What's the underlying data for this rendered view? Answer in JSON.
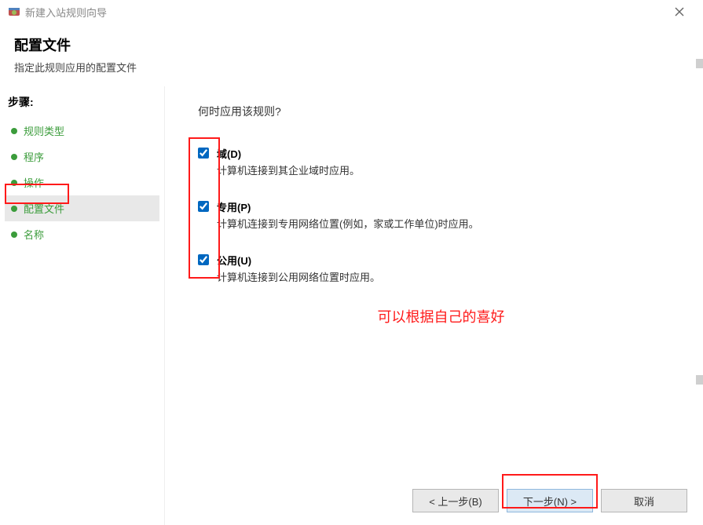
{
  "window": {
    "title": "新建入站规则向导"
  },
  "header": {
    "title": "配置文件",
    "subtitle": "指定此规则应用的配置文件"
  },
  "sidebar": {
    "steps_label": "步骤:",
    "items": [
      {
        "label": "规则类型"
      },
      {
        "label": "程序"
      },
      {
        "label": "操作"
      },
      {
        "label": "配置文件"
      },
      {
        "label": "名称"
      }
    ],
    "active_index": 3
  },
  "content": {
    "prompt": "何时应用该规则?",
    "checkboxes": [
      {
        "label": "域(D)",
        "desc": "计算机连接到其企业域时应用。",
        "checked": true
      },
      {
        "label": "专用(P)",
        "desc": "计算机连接到专用网络位置(例如，家或工作单位)时应用。",
        "checked": true
      },
      {
        "label": "公用(U)",
        "desc": "计算机连接到公用网络位置时应用。",
        "checked": true
      }
    ],
    "annotation": "可以根据自己的喜好"
  },
  "buttons": {
    "back": "< 上一步(B)",
    "next": "下一步(N) >",
    "cancel": "取消"
  }
}
